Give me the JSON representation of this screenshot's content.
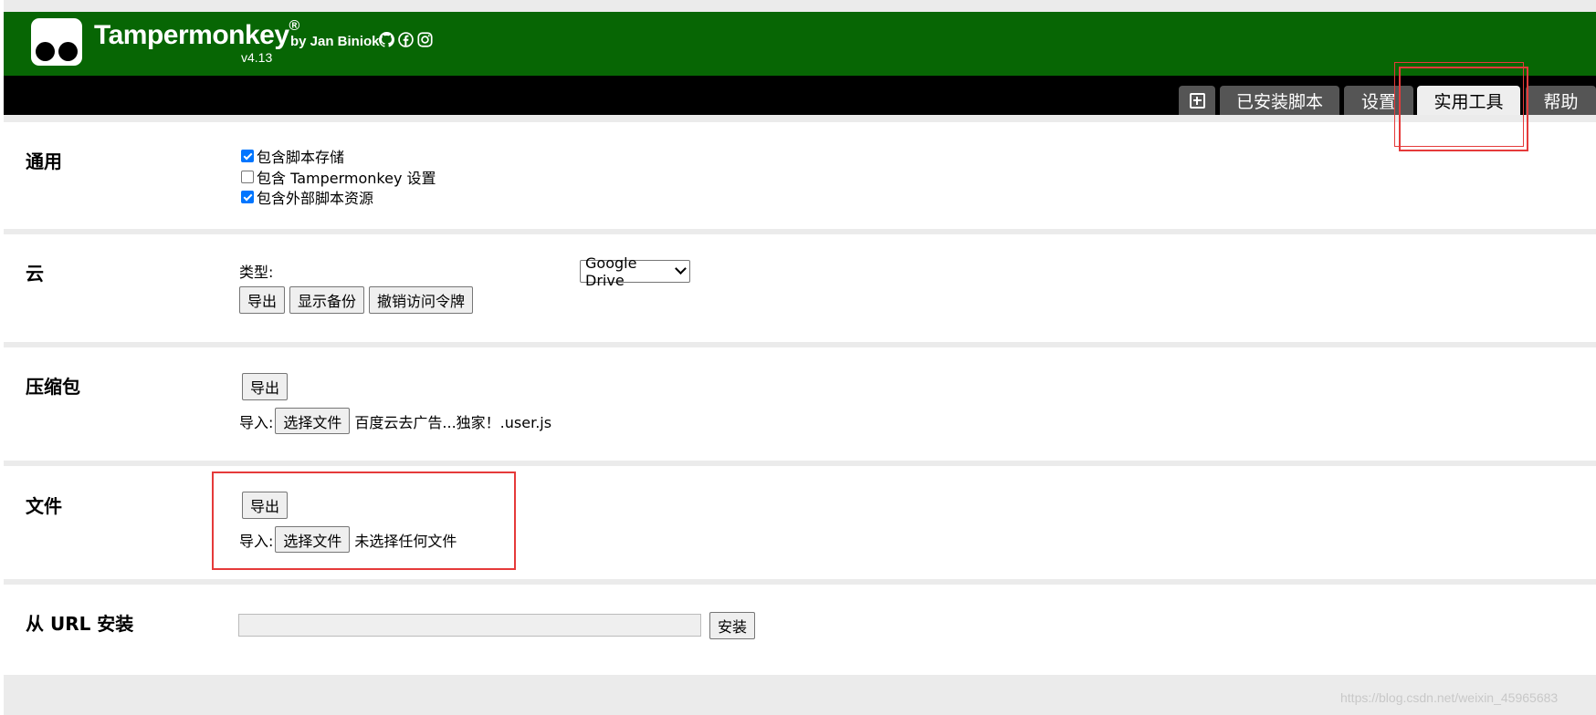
{
  "header": {
    "brand": "Tampermonkey",
    "registered": "®",
    "byline": "by Jan Biniok",
    "version": "v4.13",
    "social_icons": [
      "github-icon",
      "facebook-icon",
      "instagram-icon"
    ]
  },
  "tabs": [
    {
      "label": "",
      "icon": "plus-box-icon"
    },
    {
      "label": "已安装脚本"
    },
    {
      "label": "设置"
    },
    {
      "label": "实用工具",
      "active": true
    },
    {
      "label": "帮助"
    }
  ],
  "general": {
    "title": "通用",
    "options": [
      {
        "label": "包含脚本存储",
        "checked": true
      },
      {
        "label": "包含 Tampermonkey 设置",
        "checked": false
      },
      {
        "label": "包含外部脚本资源",
        "checked": true
      }
    ]
  },
  "cloud": {
    "title": "云",
    "type_label": "类型:",
    "type_value": "Google Drive",
    "buttons": [
      "导出",
      "显示备份",
      "撤销访问令牌"
    ]
  },
  "zip": {
    "title": "压缩包",
    "export": "导出",
    "import_label": "导入:",
    "choose": "选择文件",
    "file_name": "百度云去广告...独家！.user.js"
  },
  "file": {
    "title": "文件",
    "export": "导出",
    "import_label": "导入:",
    "choose": "选择文件",
    "file_name": "未选择任何文件"
  },
  "url_install": {
    "title": "从 URL 安装",
    "value": "",
    "button": "安装"
  },
  "watermark": "https://blog.csdn.net/weixin_45965683",
  "colors": {
    "header_green": "#076604",
    "tab_bar": "#000000",
    "tab_inactive": "#555555",
    "tab_active": "#eeeeee",
    "highlight_red": "#e53a3a",
    "checkbox_blue": "#0075ff"
  }
}
